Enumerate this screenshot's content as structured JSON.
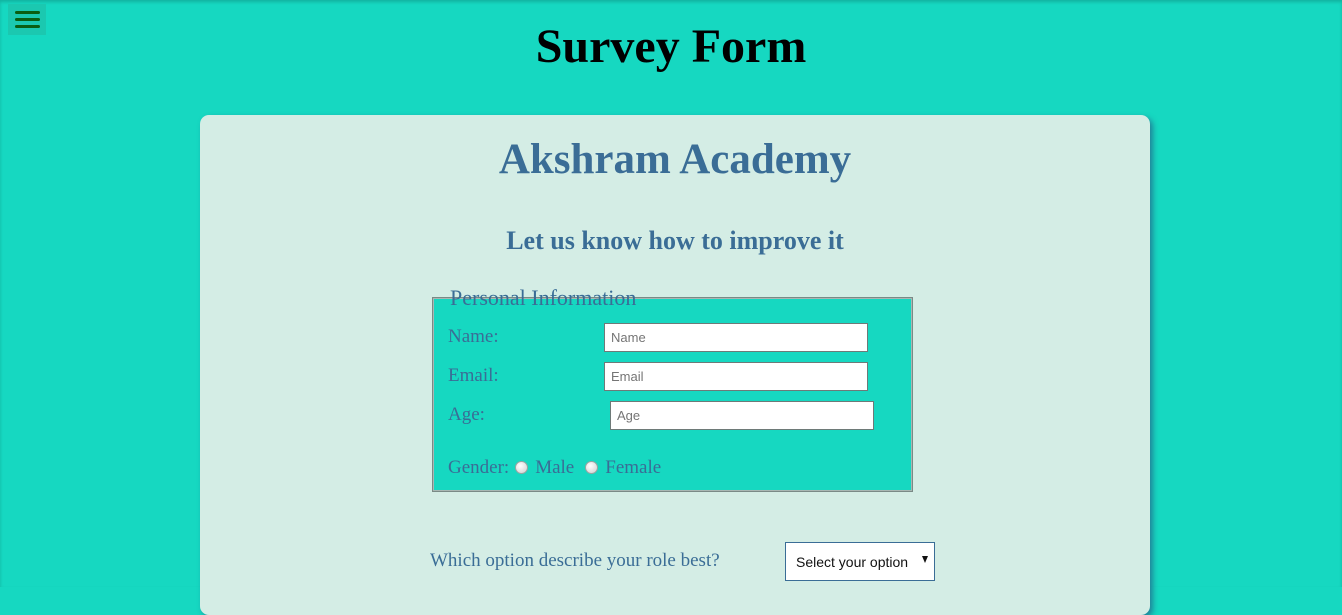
{
  "header": {
    "menu_icon": "hamburger-menu-icon",
    "title": "Survey Form"
  },
  "card": {
    "academy_name": "Akshram Academy",
    "tagline": "Let us know how to improve it"
  },
  "personal_info": {
    "legend": "Personal Information",
    "name": {
      "label": "Name:",
      "value": "",
      "placeholder": "Name"
    },
    "email": {
      "label": "Email:",
      "value": "",
      "placeholder": "Email"
    },
    "age": {
      "label": "Age:",
      "value": "",
      "placeholder": "Age"
    },
    "gender": {
      "label": "Gender:",
      "options": [
        "Male",
        "Female"
      ]
    }
  },
  "role": {
    "question": "Which option describe your role best?",
    "selected": "Select your option"
  },
  "colors": {
    "background": "#16d8c1",
    "card": "#d4ede5",
    "text_accent": "#3a6d96",
    "menu_icon": "#0a5e12"
  }
}
